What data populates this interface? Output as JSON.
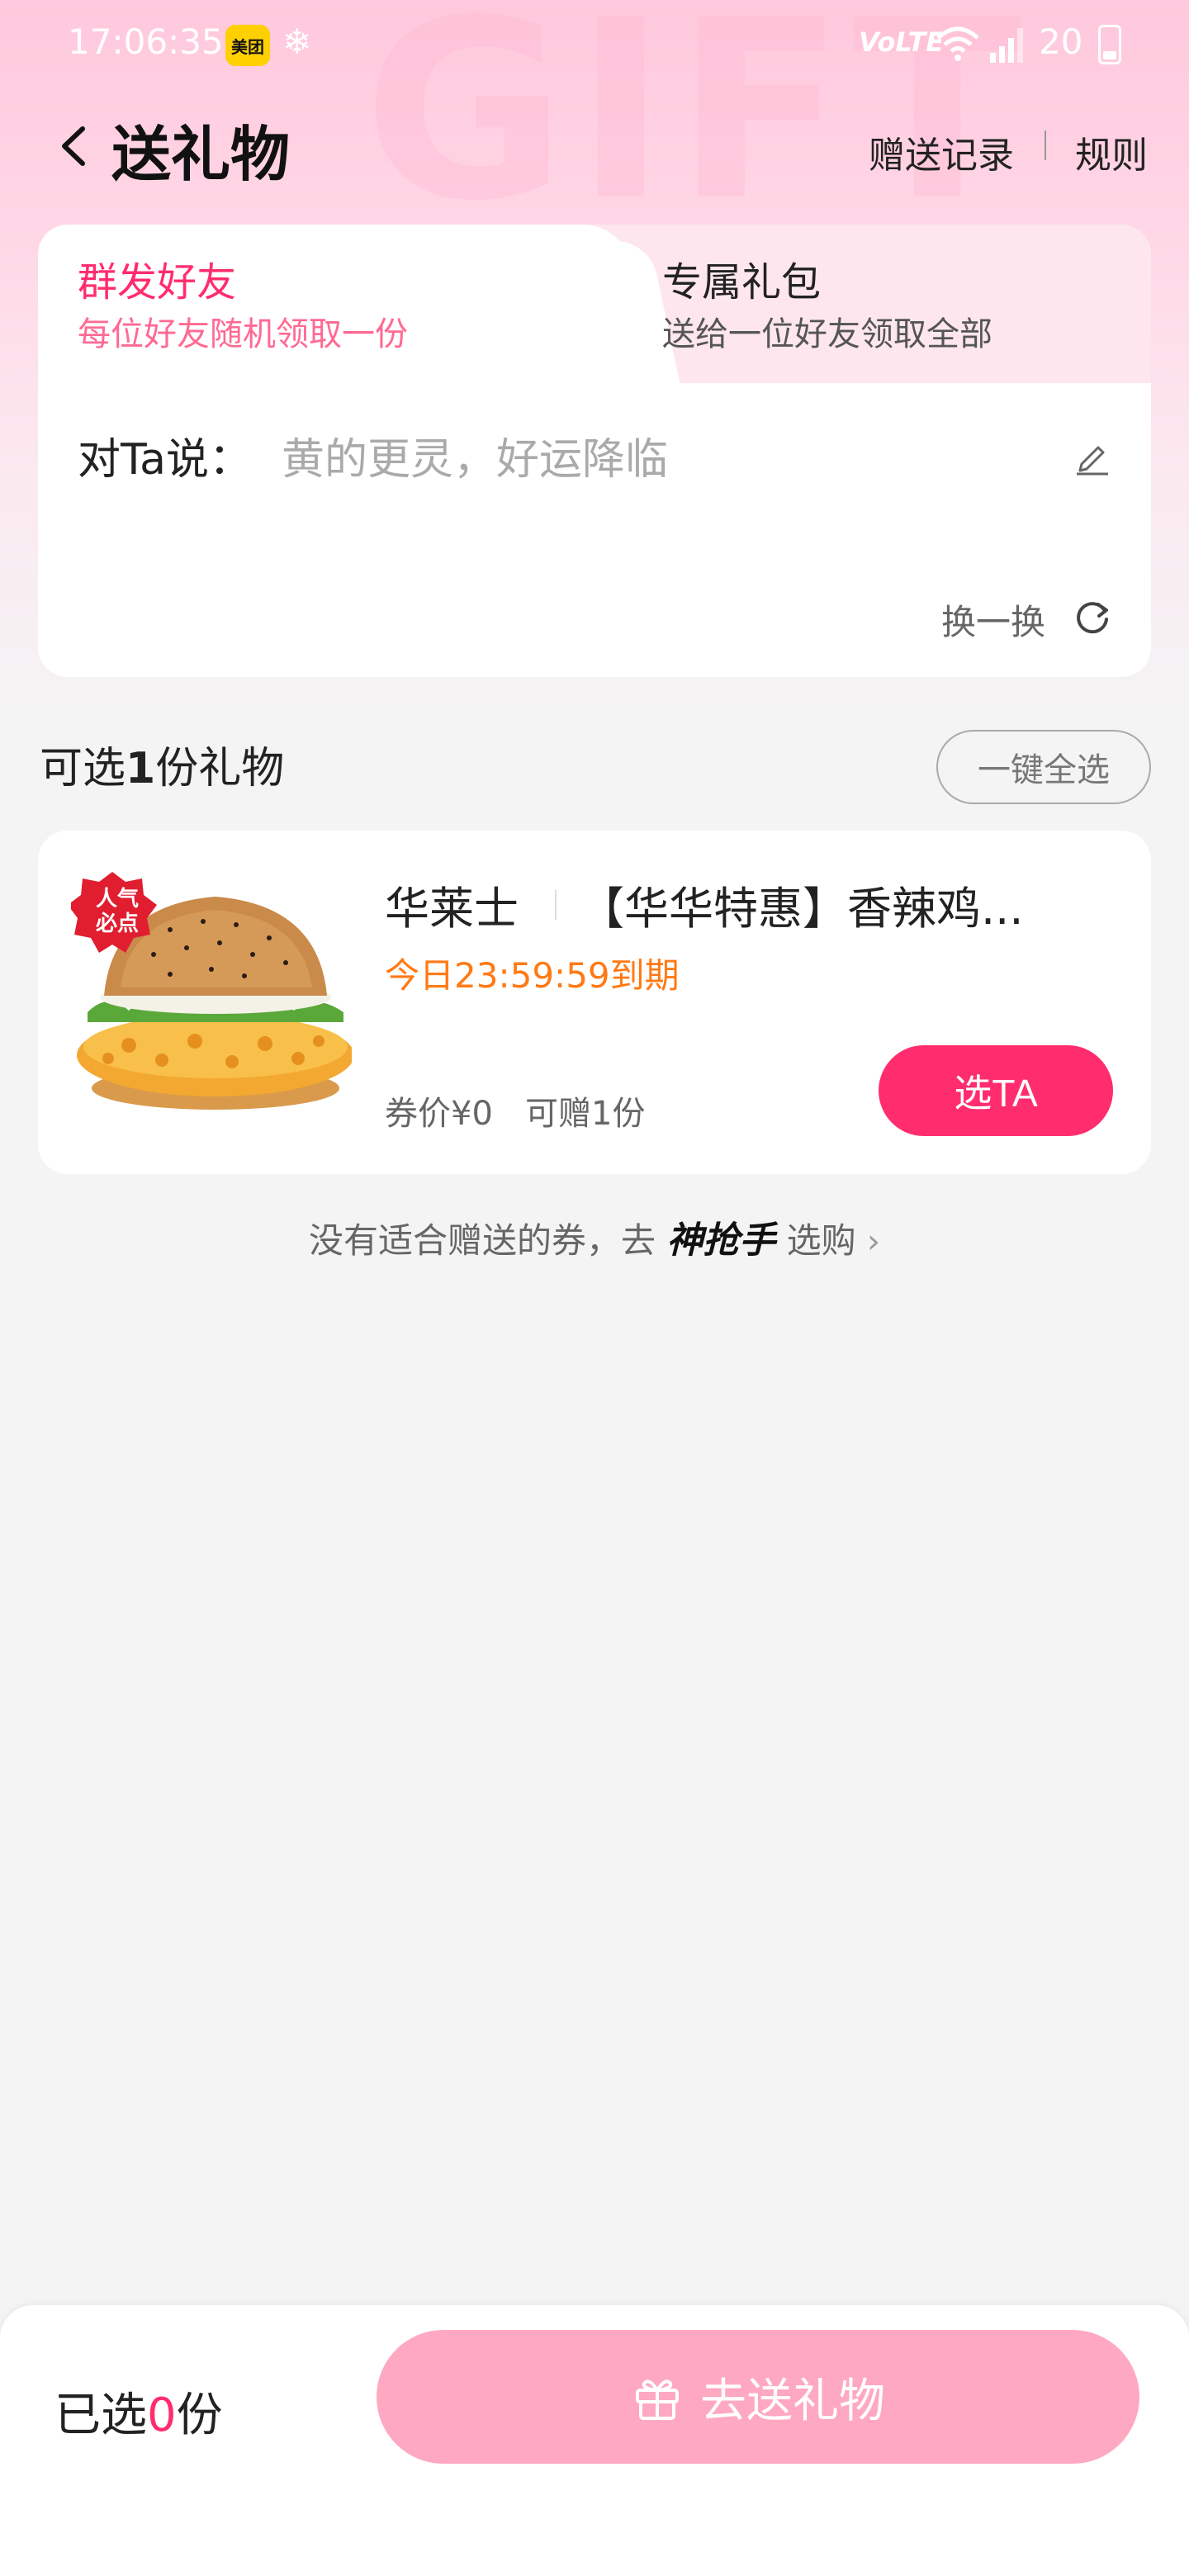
{
  "status": {
    "time": "17:06:35",
    "app_badge": "美团",
    "network": "VoLTE",
    "battery": "20"
  },
  "header": {
    "title": "送礼物",
    "records_link": "赠送记录",
    "rules_link": "规则"
  },
  "tabs": [
    {
      "title": "群发好友",
      "subtitle": "每位好友随机领取一份",
      "active": true
    },
    {
      "title": "专属礼包",
      "subtitle": "送给一位好友领取全部",
      "active": false
    }
  ],
  "message": {
    "label": "对Ta说：",
    "text": "黄的更灵，好运降临",
    "change_label": "换一换"
  },
  "gifts_section": {
    "title_prefix": "可选",
    "count": "1",
    "title_suffix": "份礼物",
    "select_all": "一键全选"
  },
  "gift": {
    "badge": "人气必点",
    "brand": "华莱士",
    "name": "【华华特惠】香辣鸡...",
    "expiry": "今日23:59:59到期",
    "price": "券价¥0",
    "quantity": "可赠1份",
    "pick_label": "选TA"
  },
  "bottom_link": {
    "prefix": "没有适合赠送的券，去",
    "brand": "神抢手",
    "suffix": "选购"
  },
  "footer": {
    "selected_prefix": "已选",
    "selected_count": "0",
    "selected_suffix": "份",
    "send_label": "去送礼物"
  },
  "colors": {
    "accent": "#ff2d6d",
    "expiry": "#ff7a14",
    "send_disabled": "#ffa8c2"
  }
}
